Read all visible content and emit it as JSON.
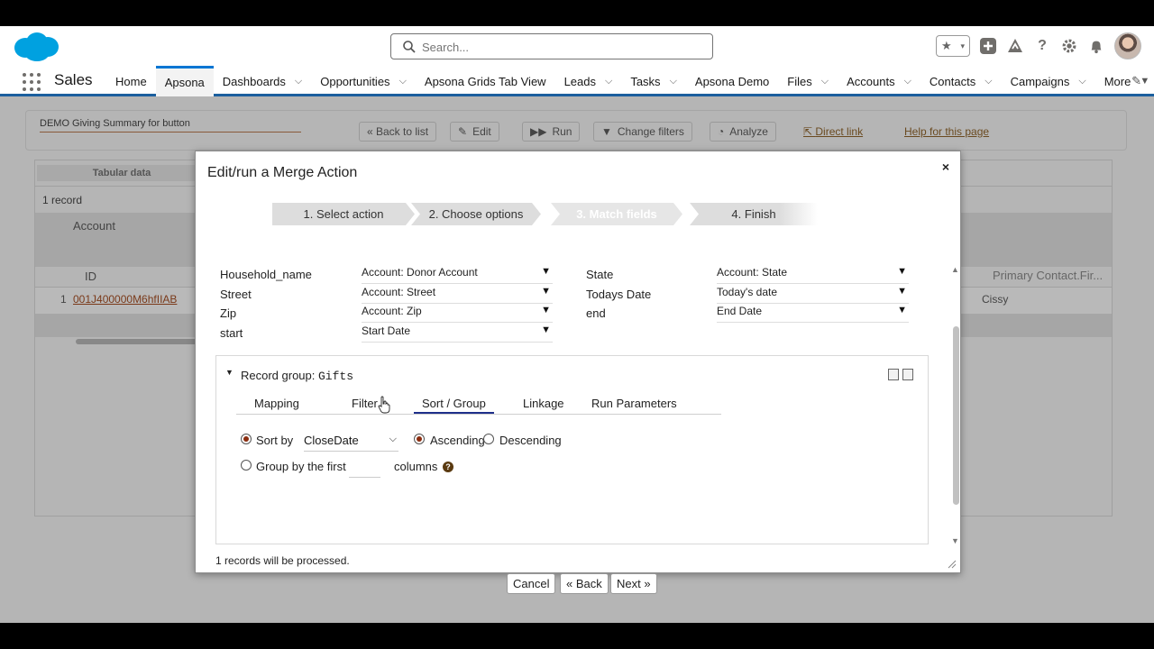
{
  "header": {
    "search_placeholder": "Search...",
    "utility_icons": [
      "favorites-star-icon",
      "add-icon",
      "trailhead-icon",
      "help-icon",
      "setup-gear-icon",
      "notifications-bell-icon"
    ]
  },
  "nav": {
    "app_name": "Sales",
    "items": [
      {
        "label": "Home",
        "chevron": false,
        "active": false
      },
      {
        "label": "Apsona",
        "chevron": false,
        "active": true
      },
      {
        "label": "Dashboards",
        "chevron": true,
        "active": false
      },
      {
        "label": "Opportunities",
        "chevron": true,
        "active": false
      },
      {
        "label": "Apsona Grids Tab View",
        "chevron": false,
        "active": false
      },
      {
        "label": "Leads",
        "chevron": true,
        "active": false
      },
      {
        "label": "Tasks",
        "chevron": true,
        "active": false
      },
      {
        "label": "Apsona Demo",
        "chevron": false,
        "active": false
      },
      {
        "label": "Files",
        "chevron": true,
        "active": false
      },
      {
        "label": "Accounts",
        "chevron": true,
        "active": false
      },
      {
        "label": "Contacts",
        "chevron": true,
        "active": false
      },
      {
        "label": "Campaigns",
        "chevron": true,
        "active": false
      },
      {
        "label": "More",
        "chevron": true,
        "active": false
      }
    ]
  },
  "background": {
    "report_title": "DEMO Giving Summary for button",
    "buttons": {
      "back": "« Back to list",
      "edit": "Edit",
      "run": "Run",
      "change_filters": "Change filters",
      "analyze": "Analyze"
    },
    "links": {
      "direct": "Direct link",
      "help": "Help for this page"
    },
    "grid": {
      "tab": "Tabular data",
      "record_count": "1 record",
      "col_account": "Account",
      "col_id": "ID",
      "row_num": "1",
      "record_id": "001J400000M6hfIIAB",
      "col_primary": "Primary Contact.Fir...",
      "primary_value": "Cissy"
    }
  },
  "modal": {
    "title": "Edit/run a Merge Action",
    "close": "×",
    "steps": [
      "1. Select action",
      "2. Choose options",
      "3. Match fields",
      "4. Finish"
    ],
    "mapping_left": [
      {
        "field": "Household_name",
        "value": "Account: Donor Account"
      },
      {
        "field": "Street",
        "value": "Account: Street"
      },
      {
        "field": "Zip",
        "value": "Account: Zip"
      },
      {
        "field": "start",
        "value": "Start Date"
      }
    ],
    "mapping_right": [
      {
        "field": "State",
        "value": "Account: State"
      },
      {
        "field": "Todays Date",
        "value": "Today's date"
      },
      {
        "field": "end",
        "value": "End Date"
      }
    ],
    "record_group": {
      "label": "Record group: ",
      "name": "Gifts",
      "tabs": [
        "Mapping",
        "Filter",
        "Sort / Group",
        "Linkage",
        "Run Parameters"
      ],
      "active_tab": "Sort / Group",
      "sort_by_label": "Sort by",
      "sort_by_value": "CloseDate",
      "ascending": "Ascending",
      "descending": "Descending",
      "group_by_label": "Group by the first",
      "columns_label": "columns",
      "help_glyph": "?"
    },
    "processed_text": "1 records will be processed.",
    "buttons": {
      "cancel": "Cancel",
      "back": "« Back",
      "next": "Next »"
    }
  },
  "colors": {
    "nav_underline": "#1b5f9e",
    "active_tab": "#0176d3",
    "salesforce_blue": "#00a1e0",
    "radio_selected": "#8b2d0f"
  }
}
